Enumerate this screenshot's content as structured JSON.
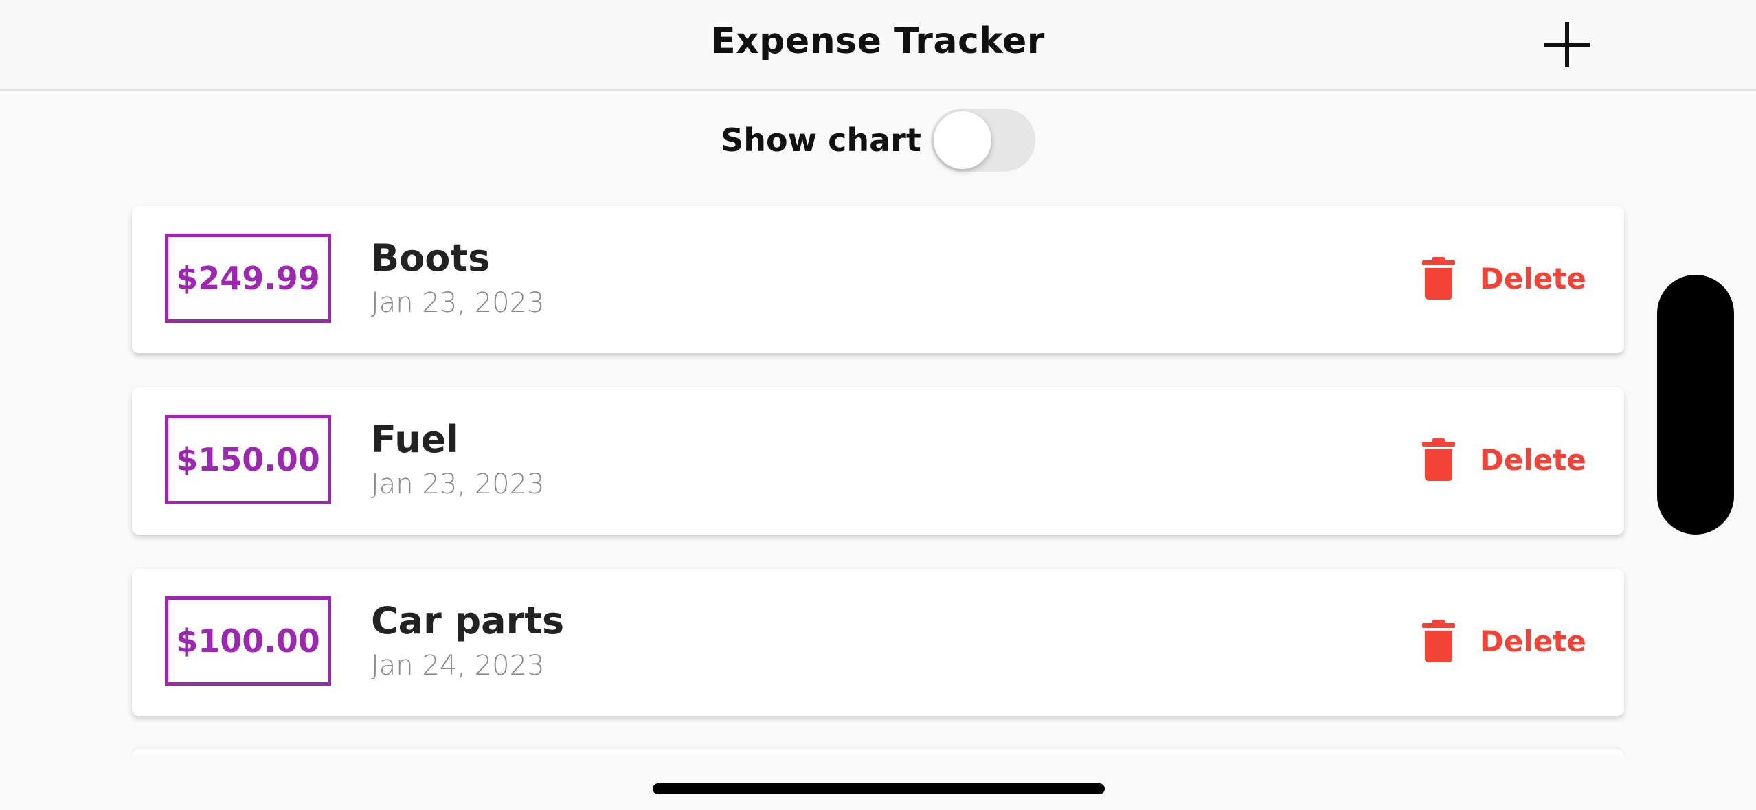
{
  "app": {
    "title": "Expense Tracker",
    "add_icon": "plus-icon"
  },
  "chart_toggle": {
    "label": "Show chart",
    "on": false
  },
  "expenses": [
    {
      "amount": "$249.99",
      "title": "Boots",
      "date": "Jan 23, 2023",
      "delete_label": "Delete"
    },
    {
      "amount": "$150.00",
      "title": "Fuel",
      "date": "Jan 23, 2023",
      "delete_label": "Delete"
    },
    {
      "amount": "$100.00",
      "title": "Car parts",
      "date": "Jan 24, 2023",
      "delete_label": "Delete"
    }
  ],
  "colors": {
    "accent": "#9c27b0",
    "danger": "#f44336",
    "background": "#fafafa"
  },
  "icons": {
    "delete": "trash-icon"
  }
}
